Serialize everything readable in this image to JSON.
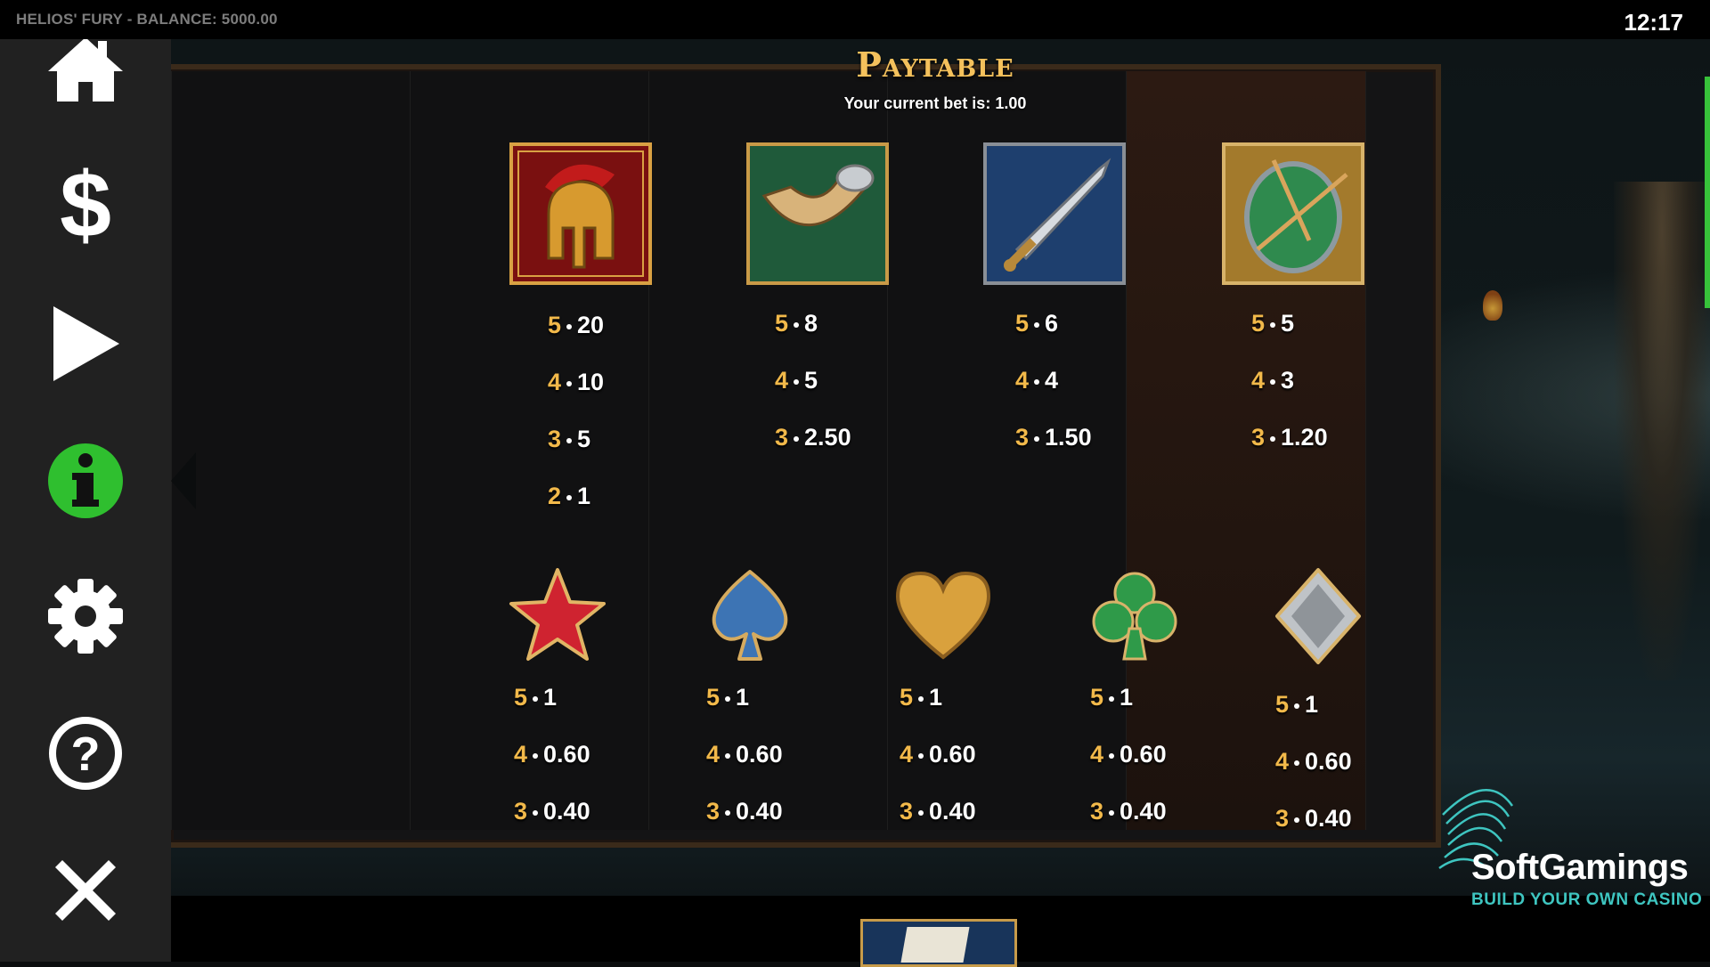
{
  "topbar": {
    "title": "HELIOS' FURY - BALANCE: 5000.00",
    "clock": "12:17"
  },
  "sidebar": {
    "items": [
      {
        "name": "home",
        "icon": "home-icon"
      },
      {
        "name": "bet",
        "icon": "dollar-icon"
      },
      {
        "name": "play",
        "icon": "play-icon"
      },
      {
        "name": "info",
        "icon": "info-icon",
        "active": true
      },
      {
        "name": "settings",
        "icon": "gear-icon"
      },
      {
        "name": "help",
        "icon": "question-icon"
      },
      {
        "name": "close",
        "icon": "close-icon"
      }
    ],
    "active_color": "#2fbf2f"
  },
  "paytable": {
    "title": "Paytable",
    "bet_text": "Your current bet is: 1.00",
    "high_symbols": [
      {
        "symbol": "helmet-icon",
        "pays": [
          {
            "count": "5",
            "value": "20"
          },
          {
            "count": "4",
            "value": "10"
          },
          {
            "count": "3",
            "value": "5"
          },
          {
            "count": "2",
            "value": "1"
          }
        ]
      },
      {
        "symbol": "horn-icon",
        "pays": [
          {
            "count": "5",
            "value": "8"
          },
          {
            "count": "4",
            "value": "5"
          },
          {
            "count": "3",
            "value": "2.50"
          }
        ]
      },
      {
        "symbol": "sword-icon",
        "pays": [
          {
            "count": "5",
            "value": "6"
          },
          {
            "count": "4",
            "value": "4"
          },
          {
            "count": "3",
            "value": "1.50"
          }
        ]
      },
      {
        "symbol": "shield-icon",
        "pays": [
          {
            "count": "5",
            "value": "5"
          },
          {
            "count": "4",
            "value": "3"
          },
          {
            "count": "3",
            "value": "1.20"
          }
        ]
      }
    ],
    "low_symbols": [
      {
        "symbol": "star-icon",
        "pays": [
          {
            "count": "5",
            "value": "1"
          },
          {
            "count": "4",
            "value": "0.60"
          },
          {
            "count": "3",
            "value": "0.40"
          }
        ]
      },
      {
        "symbol": "spade-icon",
        "pays": [
          {
            "count": "5",
            "value": "1"
          },
          {
            "count": "4",
            "value": "0.60"
          },
          {
            "count": "3",
            "value": "0.40"
          }
        ]
      },
      {
        "symbol": "heart-icon",
        "pays": [
          {
            "count": "5",
            "value": "1"
          },
          {
            "count": "4",
            "value": "0.60"
          },
          {
            "count": "3",
            "value": "0.40"
          }
        ]
      },
      {
        "symbol": "club-icon",
        "pays": [
          {
            "count": "5",
            "value": "1"
          },
          {
            "count": "4",
            "value": "0.60"
          },
          {
            "count": "3",
            "value": "0.40"
          }
        ]
      },
      {
        "symbol": "diamond-icon",
        "pays": [
          {
            "count": "5",
            "value": "1"
          },
          {
            "count": "4",
            "value": "0.60"
          },
          {
            "count": "3",
            "value": "0.40"
          }
        ]
      }
    ]
  },
  "brand": {
    "name": "SoftGamings",
    "tagline": "BUILD YOUR OWN CASINO"
  },
  "colors": {
    "gold": "#f4c15c",
    "count": "#f2b94a",
    "brand_teal": "#3ec5c0"
  }
}
